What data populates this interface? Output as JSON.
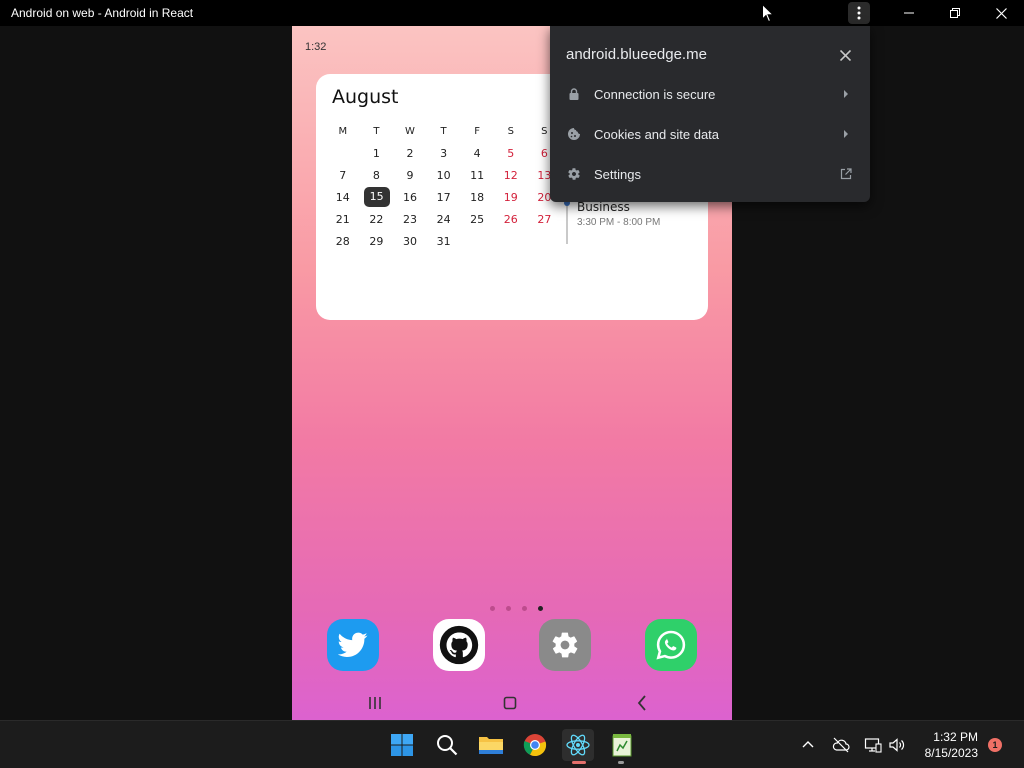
{
  "window": {
    "title": "Android on web - Android in React",
    "menu_icon": "more-vert-icon",
    "minimize_icon": "minimize-icon",
    "maximize_icon": "restore-icon",
    "close_icon": "close-icon"
  },
  "phone": {
    "status_time": "1:32",
    "calendar": {
      "month": "August",
      "weekday_headers": [
        "M",
        "T",
        "W",
        "T",
        "F",
        "S",
        "S"
      ],
      "weeks": [
        [
          "",
          "1",
          "2",
          "3",
          "4",
          "5",
          "6"
        ],
        [
          "7",
          "8",
          "9",
          "10",
          "11",
          "12",
          "13"
        ],
        [
          "14",
          "15",
          "16",
          "17",
          "18",
          "19",
          "20"
        ],
        [
          "21",
          "22",
          "23",
          "24",
          "25",
          "26",
          "27"
        ],
        [
          "28",
          "29",
          "30",
          "31",
          "",
          "",
          ""
        ]
      ],
      "today": "15",
      "weekend_color": "#d3213b"
    },
    "event": {
      "title": "Business",
      "time": "3:30 PM - 8:00 PM",
      "accent_color": "#3a71c1"
    },
    "home_page_count": 4,
    "active_page_index": 3,
    "dock": [
      {
        "name": "Twitter",
        "icon": "twitter-icon",
        "color": "#1d9bf0"
      },
      {
        "name": "GitHub",
        "icon": "github-icon",
        "color": "#ffffff"
      },
      {
        "name": "Settings",
        "icon": "settings-gear-icon",
        "color": "#8a8a8a"
      },
      {
        "name": "WhatsApp",
        "icon": "whatsapp-icon",
        "color": "#2fd06a"
      }
    ],
    "navbar": {
      "recent_icon": "recent-apps-icon",
      "home_icon": "home-icon",
      "back_icon": "back-icon"
    }
  },
  "site_info_popup": {
    "domain": "android.blueedge.me",
    "close_icon": "close-icon",
    "items": [
      {
        "label": "Connection is secure",
        "icon": "lock-icon",
        "trailing": "chevron-right-icon"
      },
      {
        "label": "Cookies and site data",
        "icon": "cookie-icon",
        "trailing": "chevron-right-icon"
      },
      {
        "label": "Settings",
        "icon": "gear-icon",
        "trailing": "external-link-icon"
      }
    ]
  },
  "taskbar": {
    "apps": [
      {
        "name": "Start",
        "icon": "windows-start-icon"
      },
      {
        "name": "Search",
        "icon": "search-icon"
      },
      {
        "name": "File Explorer",
        "icon": "folder-icon"
      },
      {
        "name": "Chrome",
        "icon": "chrome-icon"
      },
      {
        "name": "Android in React",
        "icon": "react-icon",
        "active": true
      },
      {
        "name": "Notepad",
        "icon": "notepad-icon"
      }
    ],
    "tray": {
      "chevron_icon": "chevron-up-icon",
      "cloud_icon": "cloud-offline-icon",
      "network_icon": "network-icon",
      "volume_icon": "volume-icon"
    },
    "clock_time": "1:32 PM",
    "clock_date": "8/15/2023",
    "notification_count": "1"
  }
}
